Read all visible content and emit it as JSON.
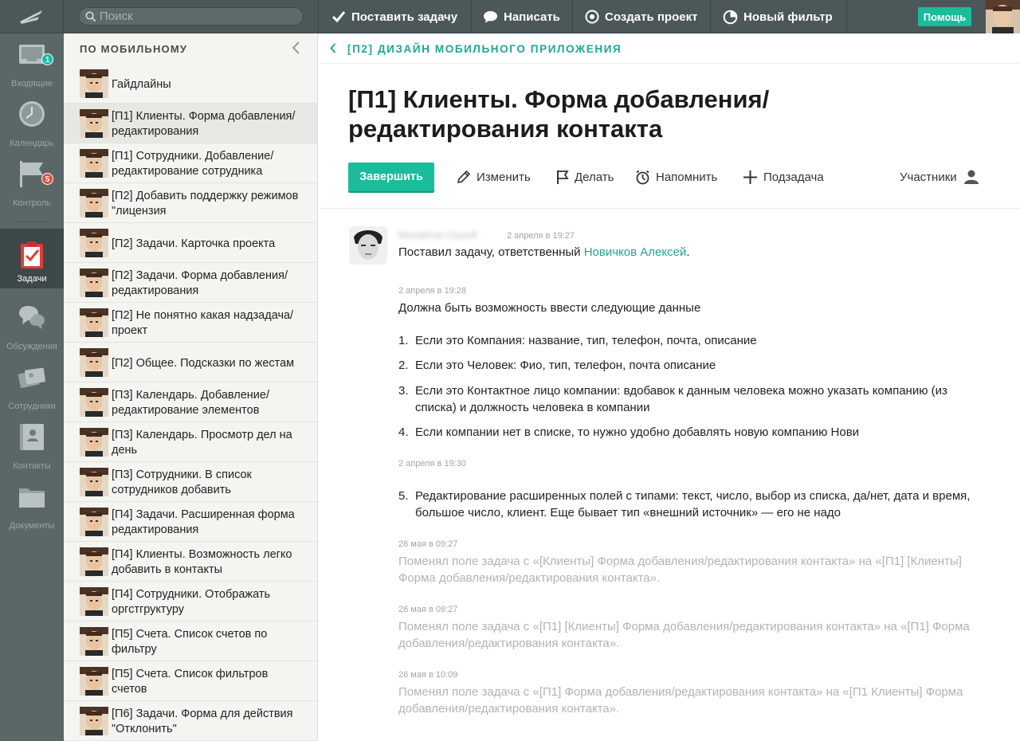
{
  "topbar": {
    "search_placeholder": "Поиск",
    "buttons": [
      {
        "label": "Поставить задачу",
        "icon": "checkmark-icon"
      },
      {
        "label": "Написать",
        "icon": "speech-bubble-icon"
      },
      {
        "label": "Создать проект",
        "icon": "target-icon"
      },
      {
        "label": "Новый фильтр",
        "icon": "pie-chart-icon"
      }
    ],
    "help_label": "Помощь"
  },
  "nav": {
    "items": [
      {
        "label": "Входящие",
        "icon": "inbox-icon",
        "badge": "1",
        "badge_color": "#1abc9c"
      },
      {
        "label": "Календарь",
        "icon": "clock-icon"
      },
      {
        "label": "Контроль",
        "icon": "flag-icon",
        "badge": "5",
        "badge_color": "#e74c3c"
      },
      {
        "label": "Задачи",
        "icon": "task-clipboard-icon",
        "active": true
      },
      {
        "label": "Обсуждения",
        "icon": "discussion-bubbles-icon"
      },
      {
        "label": "Сотрудники",
        "icon": "employees-cards-icon"
      },
      {
        "label": "Контакты",
        "icon": "contacts-book-icon"
      },
      {
        "label": "Документы",
        "icon": "folder-icon"
      }
    ]
  },
  "tasklist": {
    "title": "ПО МОБИЛЬНОМУ",
    "items": [
      {
        "title": "Гайдлайны"
      },
      {
        "title": "[П1] Клиенты. Форма добавления/редактирования",
        "selected": true
      },
      {
        "title": "[П1] Сотрудники. Добавление/редактирование сотрудника"
      },
      {
        "title": "[П2] Добавить поддержку режимов \"лицензия"
      },
      {
        "title": "[П2] Задачи. Карточка проекта"
      },
      {
        "title": "[П2] Задачи. Форма добавления/редактирования"
      },
      {
        "title": "[П2] Не понятно какая надзадача/проект"
      },
      {
        "title": "[П2] Общее. Подсказки по жестам"
      },
      {
        "title": "[П3] Календарь. Добавление/редактирование элементов"
      },
      {
        "title": "[П3] Календарь. Просмотр дел на день"
      },
      {
        "title": "[П3] Сотрудники. В список сотрудников добавить"
      },
      {
        "title": "[П4] Задачи. Расширенная форма редактирования"
      },
      {
        "title": "[П4] Клиенты. Возможность легко добавить в контакты"
      },
      {
        "title": "[П4] Сотрудники. Отображать оргстгруктуру"
      },
      {
        "title": "[П5] Счета. Список счетов по фильтру"
      },
      {
        "title": "[П5] Счета. Список фильтров счетов"
      },
      {
        "title": "[П6] Задачи. Форма для действия \"Отклонить\""
      }
    ]
  },
  "main": {
    "breadcrumb": "[П2] ДИЗАЙН МОБИЛЬНОГО ПРИЛОЖЕНИЯ",
    "title": "[П1] Клиенты. Форма добавления/ редактирования контакта",
    "actions": {
      "complete": "Завершить",
      "edit": "Изменить",
      "do": "Делать",
      "remind": "Напомнить",
      "subtask": "Подзадача",
      "participants": "Участники"
    },
    "feed": {
      "author": "Михайлов Сергей",
      "ts1": "2 апреля в 19:27",
      "msg1_prefix": "Поставил задачу, ответственный ",
      "msg1_link": "Новичков Алексей",
      "msg1_suffix": ".",
      "ts2": "2 апреля в 19:28",
      "msg2": "Должна быть возможность ввести следующие данные",
      "list": [
        {
          "num": "1.",
          "text": "Если это Компания: название, тип, телефон, почта, описание"
        },
        {
          "num": "2.",
          "text": "Если это Человек: Фио, тип, телефон, почта описание"
        },
        {
          "num": "3.",
          "text": "Если это Контактное лицо компании: вдобавок к данным человека можно указать компанию (из списка) и должность человека в компании"
        },
        {
          "num": "4.",
          "text": "Если компании нет в списке, то нужно удобно добавлять новую компанию Нови"
        }
      ],
      "ts3": "2 апреля в 19:30",
      "list2": [
        {
          "num": "5.",
          "text": "Редактирование расширенных полей с типами: текст, число, выбор из списка, да/нет, дата и время, большое число, клиент. Еще бывает тип «внешний источник» — его не надо"
        }
      ],
      "changes": [
        {
          "ts": "26 мая в 09:27",
          "text": "Поменял поле задача с «[Клиенты] Форма добавления/редактирования контакта» на «[П1] [Клиенты] Форма добавления/редактирования контакта»."
        },
        {
          "ts": "26 мая в 09:27",
          "text": "Поменял поле задача с «[П1] [Клиенты] Форма добавления/редактирования контакта» на «[П1] Форма добавления/редактирования контакта»."
        },
        {
          "ts": "26 мая в 10:09",
          "text": "Поменял поле задача с «[П1] Форма добавления/редактирования контакта» на «[П1 Клиенты] Форма добавления/редактирования контакта»."
        }
      ]
    }
  },
  "colors": {
    "accent": "#1abc9c",
    "link": "#1fa697",
    "badge_red": "#e74c3c",
    "topbar": "#4b5758"
  }
}
